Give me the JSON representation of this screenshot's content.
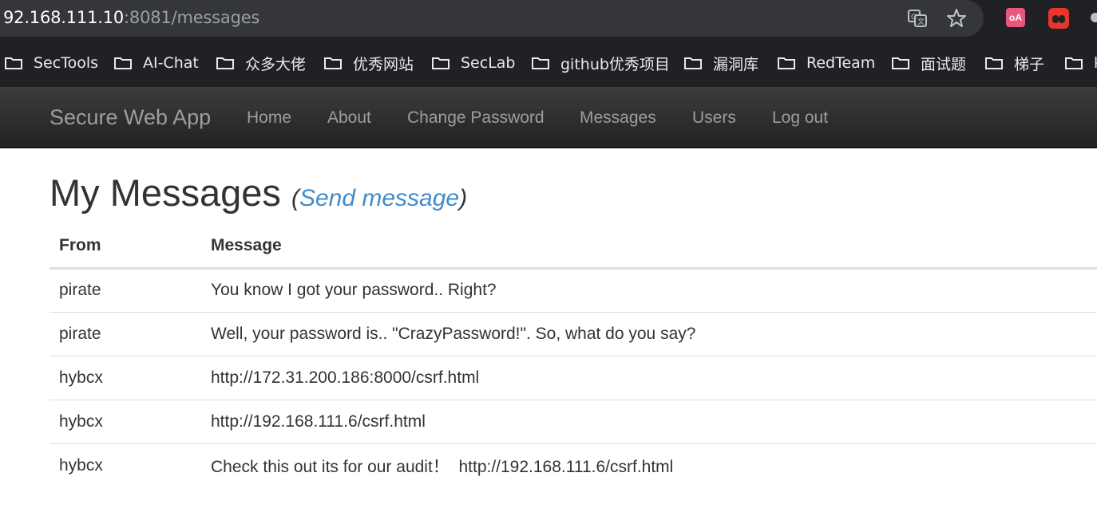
{
  "browser": {
    "url_host": "92.168.111.10",
    "url_rest": ":8081/messages",
    "ext1_text": "оA"
  },
  "bookmarks": [
    {
      "label": "SecTools"
    },
    {
      "label": "AI-Chat"
    },
    {
      "label": "众多大佬"
    },
    {
      "label": "优秀网站"
    },
    {
      "label": "SecLab"
    },
    {
      "label": "github优秀项目"
    },
    {
      "label": "漏洞库"
    },
    {
      "label": "RedTeam"
    },
    {
      "label": "面试题"
    },
    {
      "label": "梯子"
    },
    {
      "label": "k"
    }
  ],
  "navbar": {
    "brand": "Secure Web App",
    "links": [
      "Home",
      "About",
      "Change Password",
      "Messages",
      "Users",
      "Log out"
    ]
  },
  "page": {
    "title": "My Messages",
    "paren_open": "(",
    "send_link": "Send message",
    "paren_close": ")"
  },
  "table": {
    "headers": {
      "from": "From",
      "message": "Message"
    },
    "rows": [
      {
        "from": "pirate",
        "message": "You know I got your password.. Right?"
      },
      {
        "from": "pirate",
        "message": "Well, your password is.. \"CrazyPassword!\". So, what do you say?"
      },
      {
        "from": "hybcx",
        "message": "http://172.31.200.186:8000/csrf.html"
      },
      {
        "from": "hybcx",
        "message": "http://192.168.111.6/csrf.html"
      },
      {
        "from": "hybcx",
        "message": "Check this out its for our audit！  http://192.168.111.6/csrf.html"
      }
    ]
  }
}
